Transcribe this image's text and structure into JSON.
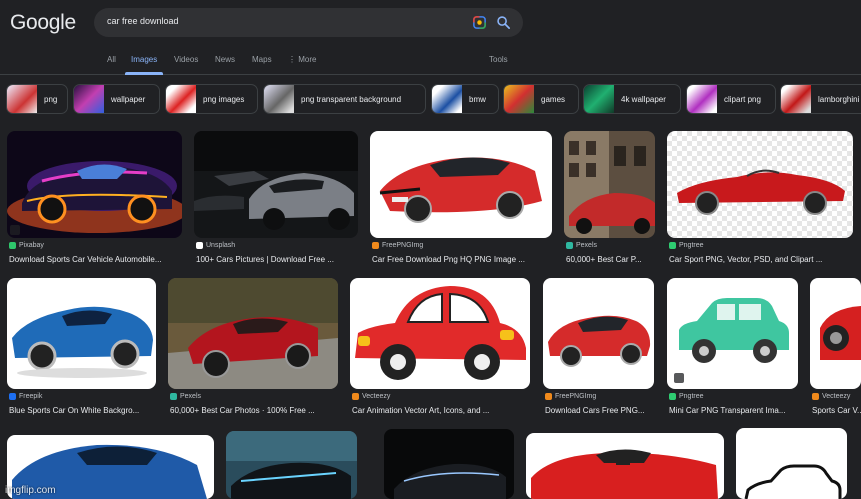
{
  "brand": {
    "logo_text": "Google"
  },
  "search": {
    "query": "car free download"
  },
  "tabs": [
    {
      "label": "All"
    },
    {
      "label": "Images",
      "active": true
    },
    {
      "label": "Videos"
    },
    {
      "label": "News"
    },
    {
      "label": "Maps"
    },
    {
      "label": "More"
    }
  ],
  "tools_label": "Tools",
  "chips": [
    {
      "label": "png"
    },
    {
      "label": "wallpaper"
    },
    {
      "label": "png images"
    },
    {
      "label": "png transparent background"
    },
    {
      "label": "bmw"
    },
    {
      "label": "games"
    },
    {
      "label": "4k wallpaper"
    },
    {
      "label": "clipart png"
    },
    {
      "label": "lamborghini"
    }
  ],
  "results": [
    {
      "source": "Pixabay",
      "caption": "Download Sports Car Vehicle Automobile..."
    },
    {
      "source": "Unsplash",
      "caption": "100+ Cars Pictures | Download Free ..."
    },
    {
      "source": "FreePNGImg",
      "caption": "Car Free Download Png HQ PNG Image ..."
    },
    {
      "source": "Pexels",
      "caption": "60,000+ Best Car P..."
    },
    {
      "source": "Pngtree",
      "caption": "Car Sport PNG, Vector, PSD, and Clipart ..."
    },
    {
      "source": "Freepik",
      "caption": "Blue Sports Car On White Backgro..."
    },
    {
      "source": "Pexels",
      "caption": "60,000+ Best Car Photos · 100% Free ..."
    },
    {
      "source": "Vecteezy",
      "caption": "Car Animation Vector Art, Icons, and ..."
    },
    {
      "source": "FreePNGImg",
      "caption": "Download Cars Free PNG..."
    },
    {
      "source": "Pngtree",
      "caption": "Mini Car PNG Transparent Ima..."
    },
    {
      "source": "Vecteezy",
      "caption": "Sports Car V..."
    }
  ],
  "watermark": "imgflip.com",
  "colors": {
    "background": "#202124",
    "accent": "#8ab4f8",
    "searchbox": "#303134"
  }
}
